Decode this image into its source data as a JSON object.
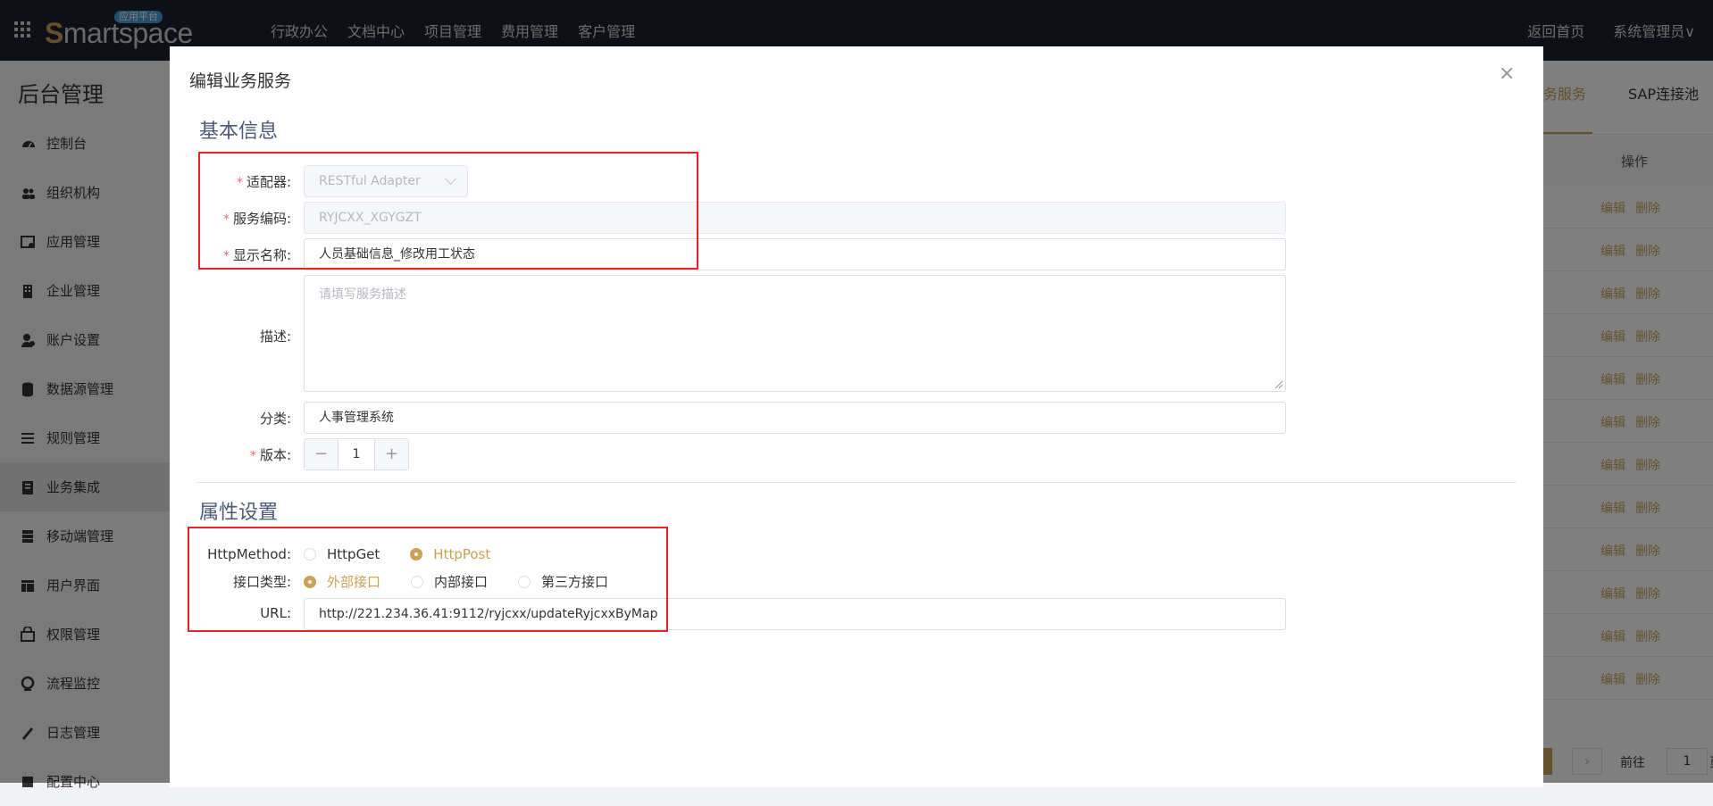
{
  "topbar": {
    "logo_text": "Smartspace",
    "logo_tag": "应用平台",
    "nav": [
      "行政办公",
      "文档中心",
      "项目管理",
      "费用管理",
      "客户管理"
    ],
    "home": "返回首页",
    "user": "系统管理员∨"
  },
  "sidebar": {
    "title": "后台管理",
    "items": [
      {
        "label": "控制台",
        "icon": "dashboard-icon"
      },
      {
        "label": "组织机构",
        "icon": "users-icon"
      },
      {
        "label": "应用管理",
        "icon": "app-settings-icon"
      },
      {
        "label": "企业管理",
        "icon": "building-icon"
      },
      {
        "label": "账户设置",
        "icon": "account-icon"
      },
      {
        "label": "数据源管理",
        "icon": "database-icon"
      },
      {
        "label": "规则管理",
        "icon": "rules-icon"
      },
      {
        "label": "业务集成",
        "icon": "integration-icon"
      },
      {
        "label": "移动端管理",
        "icon": "mobile-icon"
      },
      {
        "label": "用户界面",
        "icon": "layout-icon"
      },
      {
        "label": "权限管理",
        "icon": "permission-icon"
      },
      {
        "label": "流程监控",
        "icon": "monitor-icon"
      },
      {
        "label": "日志管理",
        "icon": "log-icon"
      },
      {
        "label": "配置中心",
        "icon": "config-icon"
      }
    ]
  },
  "background_page": {
    "tab_active": "务服务",
    "tab_other": "SAP连接池",
    "col_header": "操作",
    "row_edit": "编辑",
    "row_delete": "删除",
    "pager_goto": "前往",
    "pager_page": "1",
    "pager_unit": "页"
  },
  "modal": {
    "title": "编辑业务服务",
    "close": "×",
    "section_basic": "基本信息",
    "section_props": "属性设置",
    "adapter": {
      "label": "适配器:",
      "value": "RESTful Adapter"
    },
    "code": {
      "label": "服务编码:",
      "value": "RYJCXX_XGYGZT"
    },
    "display_name": {
      "label": "显示名称:",
      "value": "人员基础信息_修改用工状态"
    },
    "description": {
      "label": "描述:",
      "placeholder": "请填写服务描述"
    },
    "category": {
      "label": "分类:",
      "value": "人事管理系统"
    },
    "version": {
      "label": "版本:",
      "value": "1",
      "minus": "−",
      "plus": "+"
    },
    "http_method": {
      "label": "HttpMethod:",
      "options": [
        "HttpGet",
        "HttpPost"
      ],
      "selected": "HttpPost"
    },
    "interface_type": {
      "label": "接口类型:",
      "options": [
        "外部接口",
        "内部接口",
        "第三方接口"
      ],
      "selected": "外部接口"
    },
    "url": {
      "label": "URL:",
      "value": "http://221.234.36.41:9112/ryjcxx/updateRyjcxxByMap"
    }
  },
  "colors": {
    "accent": "#c9a256",
    "required": "#f56c6c",
    "highlight": "#e8212a",
    "topbar": "#1c2130"
  }
}
